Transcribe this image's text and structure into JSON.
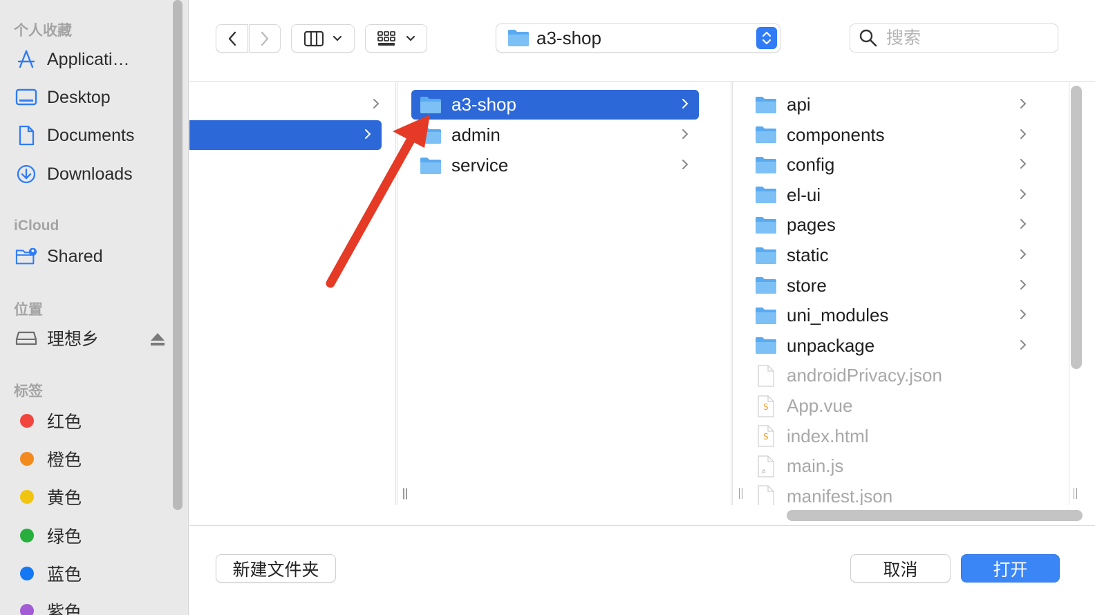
{
  "sidebar": {
    "favorites_title": "个人收藏",
    "favorites": [
      {
        "label": "Applicati…",
        "icon": "applications-icon"
      },
      {
        "label": "Desktop",
        "icon": "desktop-icon"
      },
      {
        "label": "Documents",
        "icon": "documents-icon"
      },
      {
        "label": "Downloads",
        "icon": "downloads-icon"
      }
    ],
    "icloud_title": "iCloud",
    "icloud": [
      {
        "label": "Shared",
        "icon": "shared-folder-icon"
      }
    ],
    "locations_title": "位置",
    "locations": [
      {
        "label": "理想乡",
        "icon": "disk-icon"
      }
    ],
    "tags_title": "标签",
    "tags": [
      {
        "label": "红色",
        "color": "#f2453d"
      },
      {
        "label": "橙色",
        "color": "#f28a1e"
      },
      {
        "label": "黄色",
        "color": "#f1c40f"
      },
      {
        "label": "绿色",
        "color": "#27ae3d"
      },
      {
        "label": "蓝色",
        "color": "#1478f5"
      },
      {
        "label": "紫色",
        "color": "#a35bd6"
      }
    ]
  },
  "toolbar": {
    "path": "a3-shop",
    "search_placeholder": "搜索"
  },
  "columns": {
    "col2": [
      {
        "name": "a3-shop",
        "selected": true
      },
      {
        "name": "admin",
        "selected": false
      },
      {
        "name": "service",
        "selected": false
      }
    ],
    "col3": [
      {
        "name": "api",
        "type": "folder"
      },
      {
        "name": "components",
        "type": "folder"
      },
      {
        "name": "config",
        "type": "folder"
      },
      {
        "name": "el-ui",
        "type": "folder"
      },
      {
        "name": "pages",
        "type": "folder"
      },
      {
        "name": "static",
        "type": "folder"
      },
      {
        "name": "store",
        "type": "folder"
      },
      {
        "name": "uni_modules",
        "type": "folder"
      },
      {
        "name": "unpackage",
        "type": "folder"
      },
      {
        "name": "androidPrivacy.json",
        "type": "file"
      },
      {
        "name": "App.vue",
        "type": "vue"
      },
      {
        "name": "index.html",
        "type": "vue"
      },
      {
        "name": "main.js",
        "type": "js"
      },
      {
        "name": "manifest.json",
        "type": "file"
      }
    ]
  },
  "footer": {
    "new_folder": "新建文件夹",
    "cancel": "取消",
    "open": "打开"
  },
  "colors": {
    "selection": "#2d68d8",
    "primary_button": "#3a86f7",
    "annotation_arrow": "#e53a25",
    "folder": "#5aaaf0"
  }
}
